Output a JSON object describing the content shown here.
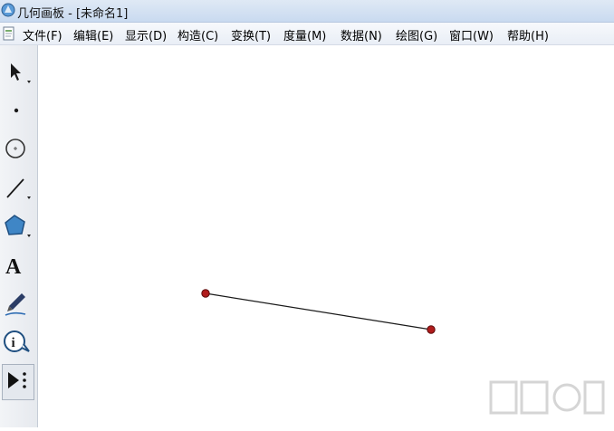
{
  "window": {
    "title": "几何画板 - [未命名1]"
  },
  "menu": {
    "items": [
      {
        "label": "文件(F)"
      },
      {
        "label": "编辑(E)"
      },
      {
        "label": "显示(D)"
      },
      {
        "label": "构造(C)"
      },
      {
        "label": "变换(T)"
      },
      {
        "label": "度量(M)"
      },
      {
        "label": "数据(N)"
      },
      {
        "label": "绘图(G)"
      },
      {
        "label": "窗口(W)"
      },
      {
        "label": "帮助(H)"
      }
    ]
  },
  "toolbar": {
    "tools": [
      {
        "name": "selection-arrow-icon",
        "active": false
      },
      {
        "name": "point-tool-icon",
        "active": false
      },
      {
        "name": "compass-tool-icon",
        "active": false
      },
      {
        "name": "straightedge-tool-icon",
        "active": false
      },
      {
        "name": "polygon-tool-icon",
        "active": false
      },
      {
        "name": "text-tool-icon",
        "active": false
      },
      {
        "name": "marker-tool-icon",
        "active": false
      },
      {
        "name": "information-tool-icon",
        "active": false
      },
      {
        "name": "custom-tool-icon",
        "active": true
      }
    ]
  },
  "colors": {
    "point": "#b01c1c",
    "segment": "#1a1a1a",
    "accent": "#2a6fb5"
  }
}
